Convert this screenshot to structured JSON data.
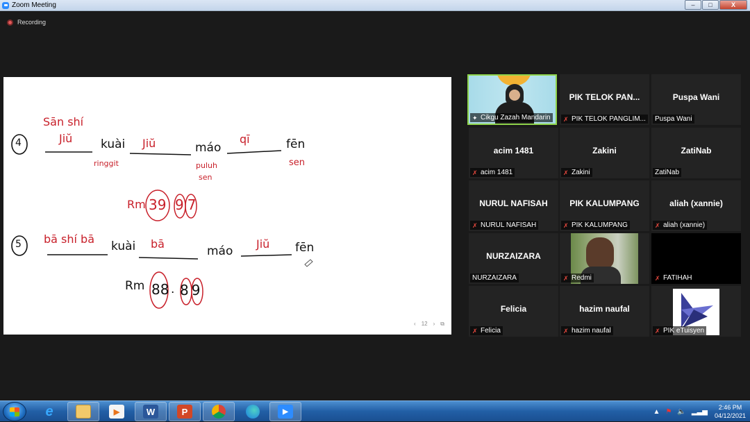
{
  "window": {
    "title": "Zoom Meeting",
    "minimize": "–",
    "maximize": "□",
    "close": "X"
  },
  "recording": {
    "label": "Recording"
  },
  "share": {
    "row4": {
      "num": "4",
      "pinyin_top": "Sān shí",
      "w1": "Jiŭ",
      "kuai": "kuài",
      "w2": "Jiŭ",
      "mao": "máo",
      "w3": "qī",
      "fen": "fēn",
      "note1": "ringgit",
      "note2a": "puluh",
      "note2b": "sen",
      "note3": "sen",
      "rm": "Rm",
      "digits1": "39",
      "digits2": "97"
    },
    "row5": {
      "num": "5",
      "w1": "bā shí bā",
      "kuai": "kuài",
      "w2": "bā",
      "mao": "máo",
      "w3": "Jiŭ",
      "fen": "fēn",
      "rm": "Rm",
      "digits1": "88",
      "dot": ".",
      "digits2": "89"
    },
    "pager": {
      "prev": "‹",
      "page": "12",
      "next": "›",
      "icon": "⧉"
    }
  },
  "participants": [
    {
      "name": "Cikgu Zazah Mandarin",
      "label": "Cikgu Zazah Mandarin",
      "video": true,
      "active": true,
      "muted": false
    },
    {
      "name": "PIK TELOK PAN...",
      "label": "PIK TELOK PANGLIM...",
      "muted": true
    },
    {
      "name": "Puspa Wani",
      "label": "Puspa Wani",
      "muted": false
    },
    {
      "name": "acim 1481",
      "label": "acim 1481",
      "muted": true
    },
    {
      "name": "Zakini",
      "label": "Zakini",
      "muted": true
    },
    {
      "name": "ZatiNab",
      "label": "ZatiNab",
      "muted": false
    },
    {
      "name": "NURUL NAFISAH",
      "label": "NURUL NAFISAH",
      "muted": true
    },
    {
      "name": "PIK KALUMPANG",
      "label": "PIK KALUMPANG",
      "muted": true
    },
    {
      "name": "aliah (xannie)",
      "label": "aliah (xannie)",
      "muted": true
    },
    {
      "name": "NURZAIZARA",
      "label": "NURZAIZARA",
      "muted": false
    },
    {
      "name": "",
      "label": "Redmi",
      "video": true,
      "muted": true
    },
    {
      "name": "",
      "label": "FATIHAH",
      "muted": true,
      "black": true
    },
    {
      "name": "Felicia",
      "label": "Felicia",
      "muted": true
    },
    {
      "name": "hazim naufal",
      "label": "hazim naufal",
      "muted": true
    },
    {
      "name": "",
      "label": "PIK eTuisyen",
      "logo": true,
      "muted": true
    }
  ],
  "taskbar": {
    "apps": [
      "ie-icon",
      "explorer-icon",
      "media-player-icon",
      "word-icon",
      "powerpoint-icon",
      "chrome-icon",
      "edge-icon",
      "zoom-icon"
    ],
    "time": "2:46 PM",
    "date": "04/12/2021",
    "colors": {
      "word": "#2b579a",
      "powerpoint": "#d24726",
      "zoom": "#2d8cff"
    }
  }
}
